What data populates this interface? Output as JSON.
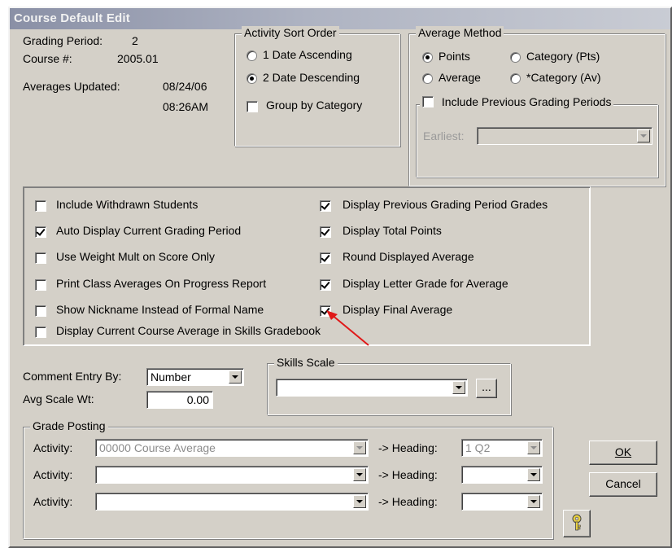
{
  "window": {
    "title": "Course Default Edit"
  },
  "info": {
    "grading_period_label": "Grading Period:",
    "grading_period_value": "2",
    "course_label": "Course #:",
    "course_value": "2005.01",
    "averages_updated_label": "Averages Updated:",
    "averages_updated_date": "08/24/06",
    "averages_updated_time": "08:26AM"
  },
  "sort_order": {
    "title": "Activity Sort Order",
    "option1": "1 Date Ascending",
    "option2": "2 Date Descending",
    "group_by": "Group by Category"
  },
  "average_method": {
    "title": "Average Method",
    "points": "Points",
    "category_pts": "Category (Pts)",
    "average": "Average",
    "category_av": "*Category (Av)",
    "include_previous": "Include Previous Grading Periods",
    "earliest_label": "Earliest:"
  },
  "options": {
    "include_withdrawn": "Include Withdrawn Students",
    "auto_display": "Auto Display Current Grading Period",
    "use_weight": "Use Weight Mult on Score Only",
    "print_class_averages": "Print Class Averages On Progress Report",
    "show_nickname": "Show Nickname Instead of Formal Name",
    "display_current_course": "Display Current Course Average in Skills Gradebook",
    "display_previous": "Display Previous Grading Period Grades",
    "display_total": "Display Total Points",
    "round_displayed": "Round Displayed Average",
    "display_letter": "Display Letter Grade for Average",
    "display_final": "Display Final Average"
  },
  "comment": {
    "entry_label": "Comment Entry By:",
    "entry_value": "Number",
    "avg_scale_label": "Avg Scale Wt:",
    "avg_scale_value": "0.00"
  },
  "skills_scale": {
    "title": "Skills Scale",
    "value": "",
    "browse_label": "..."
  },
  "grade_posting": {
    "title": "Grade Posting",
    "activity_label": "Activity:",
    "heading_label": "-> Heading:",
    "rows": [
      {
        "activity": "00000 Course Average",
        "heading": "1 Q2"
      },
      {
        "activity": "",
        "heading": ""
      },
      {
        "activity": "",
        "heading": ""
      }
    ]
  },
  "buttons": {
    "ok": "OK",
    "cancel": "Cancel",
    "help_icon": "key-icon"
  },
  "colors": {
    "dialog_bg": "#d4d0c8",
    "title_bar": "#9aa0b4",
    "arrow": "#e01818"
  }
}
